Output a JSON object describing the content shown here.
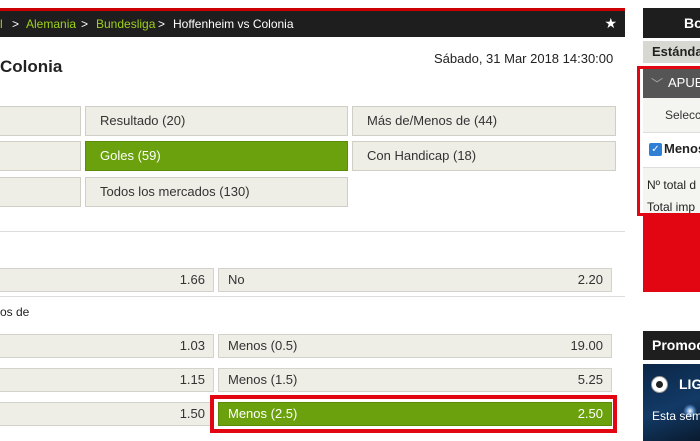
{
  "breadcrumb": {
    "items": [
      "Alemania",
      "Bundesliga",
      "Hoffenheim vs Colonia"
    ],
    "separator": ">",
    "partial_first": "l"
  },
  "match": {
    "title_visible": "Colonia",
    "datetime": "Sábado, 31 Mar 2018 14:30:00"
  },
  "markets": {
    "buttons": [
      {
        "label": "Resultado (20)"
      },
      {
        "label": "Más de/Menos de (44)"
      },
      {
        "label": "Goles (59)",
        "active": true
      },
      {
        "label": "Con Handicap (18)"
      },
      {
        "label": "Todos los mercados (130)"
      }
    ]
  },
  "odds": {
    "top_row": {
      "left_value": "1.66",
      "right_label": "No",
      "right_value": "2.20"
    },
    "section_title_partial": "os de",
    "rows": [
      {
        "left_value": "1.03",
        "right_label": "Menos (0.5)",
        "right_value": "19.00"
      },
      {
        "left_value": "1.15",
        "right_label": "Menos (1.5)",
        "right_value": "5.25"
      },
      {
        "left_value": "1.50",
        "right_label": "Menos (2.5)",
        "right_value": "2.50",
        "selected": true
      }
    ]
  },
  "bet_slip": {
    "header_partial": "Bo",
    "tab_partial": "Estánda",
    "group_partial": "APUE",
    "select_partial": "Selecc",
    "selection_partial": "Menos",
    "total_label_partial": "Nº total d",
    "amount_label_partial": "Total imp"
  },
  "promo": {
    "header_partial": "Promoc",
    "banner_title_partial": "LIG",
    "banner_text_partial": "Esta sem"
  },
  "colors": {
    "accent_green": "#6aa10c",
    "highlight_red": "#e20613",
    "dark_bar": "#1e1e1e"
  }
}
